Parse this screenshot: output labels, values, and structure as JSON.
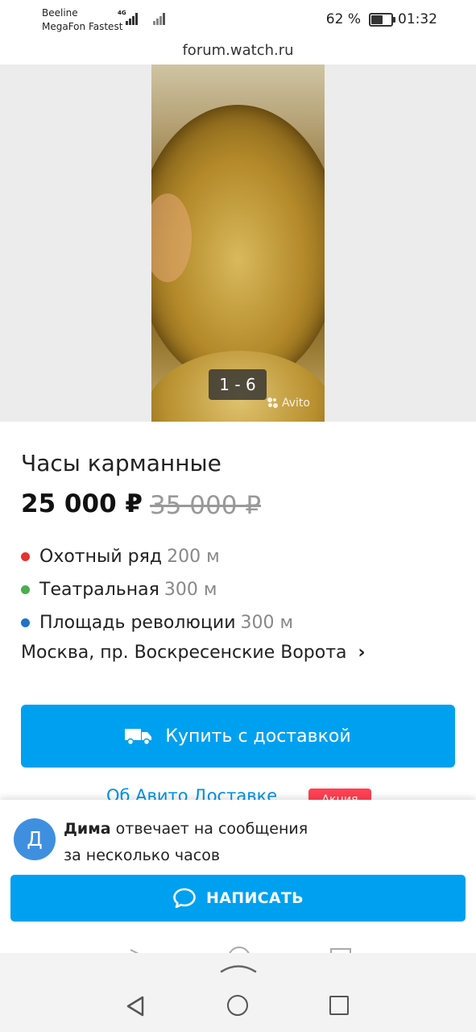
{
  "status_bar": {
    "carrier1": "Beeline",
    "carrier2": "MegaFon Fastest",
    "network": "4G",
    "battery": "62 %",
    "battery_level": 0.62,
    "time": "01:32"
  },
  "browser": {
    "url": "forum.watch.ru"
  },
  "gallery": {
    "counter": "1 - 6",
    "watermark": "Avito"
  },
  "listing": {
    "title": "Часы карманные",
    "price": "25 000 ₽",
    "old_price": "35 000 ₽",
    "metro": [
      {
        "name": "Охотный ряд",
        "distance": "200 м",
        "color": "#e4332f"
      },
      {
        "name": "Театральная",
        "distance": "300 м",
        "color": "#4bae4f"
      },
      {
        "name": "Площадь революции",
        "distance": "300 м",
        "color": "#1f74c4"
      }
    ],
    "address": "Москва, пр. Воскресенские Ворота",
    "buy_button": "Купить с доставкой",
    "delivery_link": "Об Авито Доставке",
    "promo_badge": "Акция"
  },
  "seller_sheet": {
    "avatar_letter": "Д",
    "seller_name": "Дима",
    "reply_text": "отвечает на сообщения",
    "reply_time": "за несколько часов",
    "write_button": "НАПИСАТЬ"
  },
  "colors": {
    "accent": "#00a0f0",
    "avatar": "#3f8fe0",
    "promo": "#ff4053"
  }
}
